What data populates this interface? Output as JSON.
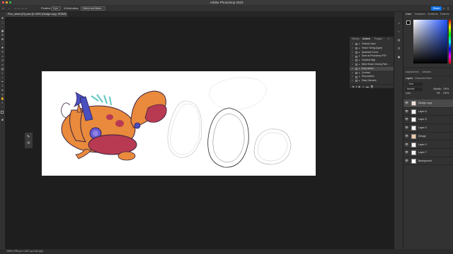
{
  "app": {
    "title": "Adobe Photoshop 2023"
  },
  "options_bar": {
    "home_icon": "home-icon",
    "feather_label": "Feather:",
    "feather_value": "0 px",
    "anti_alias_label": "Anti-alias",
    "select_mask_label": "Select and Mask...",
    "share_label": "Share"
  },
  "document": {
    "tab_label": "Pino_sheet (91).psd @ 100% (Design copy, RGB/8) *"
  },
  "actions_panel": {
    "tabs": [
      "History",
      "Actions",
      "Plugins"
    ],
    "active_tab": "Actions",
    "rows": [
      {
        "label": "Vertical Lasso",
        "checked": true
      },
      {
        "label": "Vector Timing (layer)",
        "checked": true
      },
      {
        "label": "Quadrant Colors",
        "checked": true
      },
      {
        "label": "Save as Photoshop PDF",
        "checked": true
      },
      {
        "label": "Gradient Map",
        "checked": true
      },
      {
        "label": "Mixer Brush Cloning Pain...",
        "checked": true
      },
      {
        "label": "Easy stroke",
        "checked": true,
        "selected": true
      },
      {
        "label": "Contract",
        "checked": true
      },
      {
        "label": "Stop actions",
        "checked": true
      },
      {
        "label": "Easy Outcome",
        "checked": true
      }
    ]
  },
  "right_panels": {
    "color_tabs": [
      "Color",
      "Swatches",
      "Gradients",
      "Patterns"
    ],
    "adjust_tabs": [
      "Adjustments",
      "Libraries"
    ],
    "layers_tabs": [
      "Layers",
      "Channels",
      "Paths"
    ],
    "blend_mode": "Normal",
    "opacity_label": "Opacity:",
    "opacity_value": "100%",
    "lock_label": "Lock:",
    "fill_label": "Fill:",
    "fill_value": "100%",
    "kind_label": "Kind"
  },
  "layers": [
    {
      "name": "Design copy",
      "selected": true
    },
    {
      "name": "Layer 6"
    },
    {
      "name": "Layer 5"
    },
    {
      "name": "Layer 4"
    },
    {
      "name": "Design"
    },
    {
      "name": "Layer 3"
    },
    {
      "name": "Layer 7"
    },
    {
      "name": "Background"
    }
  ],
  "status": {
    "text": "100%   3736 px x 1047 px (144 ppi)"
  },
  "colors": {
    "accent": "#1473e6",
    "foreground": "#000000",
    "background": "#ffffff",
    "canvas": "#ffffff",
    "orange": "#e98a3c",
    "crimson": "#b83a52",
    "blue": "#4a4fbf"
  },
  "icons": [
    "home-icon",
    "move-icon",
    "marquee-icon",
    "lasso-icon",
    "brush-icon",
    "eraser-icon",
    "text-icon",
    "hand-icon",
    "zoom-icon",
    "eye-icon",
    "search-icon"
  ]
}
